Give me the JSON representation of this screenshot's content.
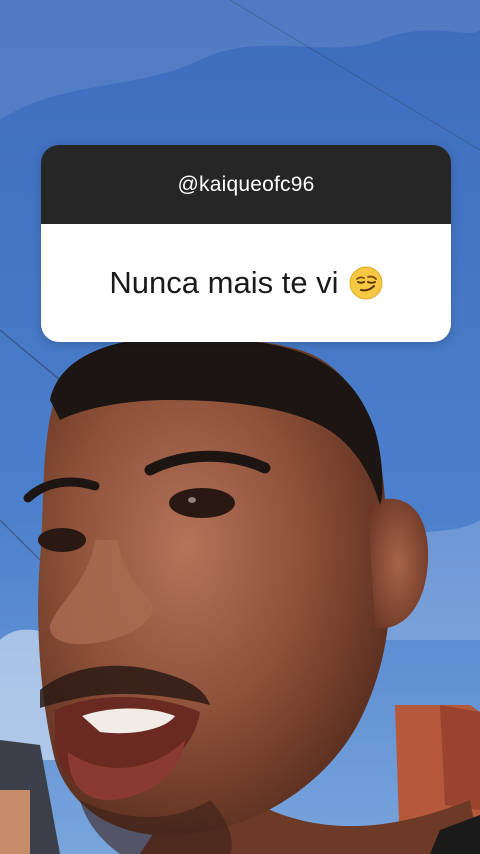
{
  "story": {
    "question": {
      "username": "@kaiqueofc96",
      "text": "Nunca mais te vi",
      "emoji": "smirking-face-emoji"
    }
  },
  "colors": {
    "sky": "#4b7fcc",
    "card_header": "#262626",
    "card_body": "#ffffff",
    "emoji": "#f7c843"
  }
}
